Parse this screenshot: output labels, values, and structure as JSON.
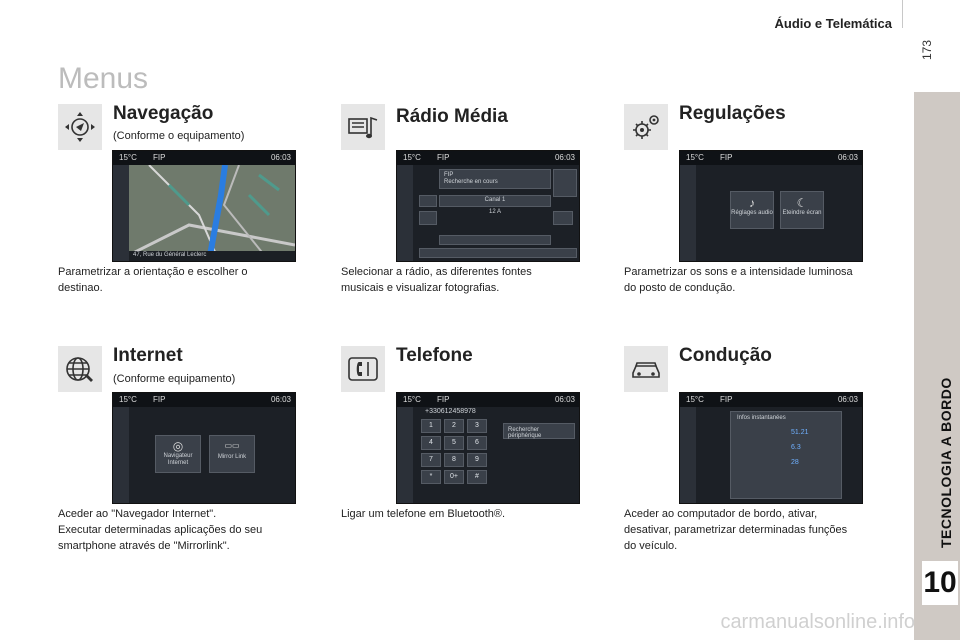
{
  "header": {
    "title": "Áudio e Telemática",
    "page": "173"
  },
  "side_tab": {
    "label": "TECNOLOGIA A BORDO",
    "chapter": "10"
  },
  "page_title": "Menus",
  "sections": {
    "navegacao": {
      "title": "Navegação",
      "note": "(Conforme o equipamento)",
      "desc1": "Parametrizar a orientação e escolher o",
      "desc2": "destinao.",
      "screen": {
        "temp": "15°C",
        "source": "FIP",
        "time": "06:03",
        "address": "47, Rue du Général Leclerc"
      }
    },
    "radio": {
      "title": "Rádio Média",
      "desc1": "Selecionar a rádio, as diferentes fontes",
      "desc2": "musicais e visualizar fotografias.",
      "screen": {
        "temp": "15°C",
        "source": "FIP",
        "time": "06:03",
        "station": "FIP",
        "search": "Recherche en cours",
        "channel": "Canal 1",
        "freq": "12 A"
      }
    },
    "regulacoes": {
      "title": "Regulações",
      "desc1": "Parametrizar os sons e a intensidade luminosa",
      "desc2": "do posto de condução.",
      "screen": {
        "temp": "15°C",
        "source": "FIP",
        "time": "06:03",
        "btn1": "Réglages audio",
        "btn2": "Eteindre écran"
      }
    },
    "internet": {
      "title": "Internet",
      "note": "(Conforme equipamento)",
      "desc1": "Aceder ao \"Navegador Internet\".",
      "desc2": "Executar determinadas aplicações do seu",
      "desc3": "smartphone através de \"Mirrorlink\".",
      "screen": {
        "temp": "15°C",
        "source": "FIP",
        "time": "06:03",
        "btn1": "Navigateur Internet",
        "btn2": "Mirror Link"
      }
    },
    "telefone": {
      "title": "Telefone",
      "desc1": "Ligar um telefone em Bluetooth®.",
      "screen": {
        "temp": "15°C",
        "source": "FIP",
        "time": "06:03",
        "number": "+330612458978",
        "search": "Rechercher périphérique",
        "keys": [
          "1",
          "2",
          "3",
          "4",
          "5",
          "6",
          "7",
          "8",
          "9",
          "*",
          "0+",
          "#"
        ]
      }
    },
    "conducao": {
      "title": "Condução",
      "desc1": "Aceder ao computador de bordo, ativar,",
      "desc2": "desativar, parametrizar determinadas funções",
      "desc3": "do veículo.",
      "screen": {
        "temp": "15°C",
        "source": "FIP",
        "time": "06:03",
        "heading": "Infos instantanées",
        "v1": "51.21",
        "v2": "6.3",
        "v3": "28"
      }
    }
  },
  "watermark": "carmanualsonline.info"
}
